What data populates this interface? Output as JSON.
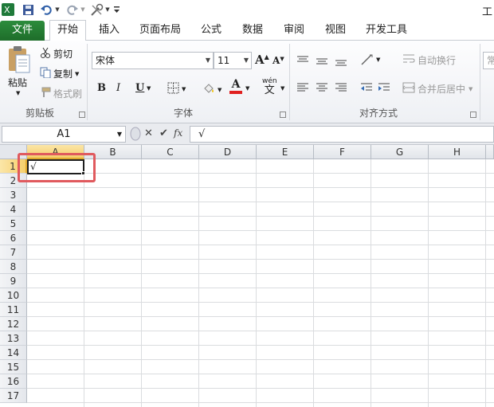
{
  "quick_access": {
    "excel_icon": "excel-app-icon",
    "save_icon": "save-icon",
    "undo_icon": "undo-icon",
    "redo_icon": "redo-icon",
    "tools_icon": "tools-icon",
    "customize_icon": "customize-qat-icon"
  },
  "window": {
    "title_fragment": "工"
  },
  "tabs": [
    {
      "label": "文件"
    },
    {
      "label": "开始"
    },
    {
      "label": "插入"
    },
    {
      "label": "页面布局"
    },
    {
      "label": "公式"
    },
    {
      "label": "数据"
    },
    {
      "label": "审阅"
    },
    {
      "label": "视图"
    },
    {
      "label": "开发工具"
    }
  ],
  "ribbon": {
    "clipboard": {
      "label": "剪贴板",
      "paste": "粘贴",
      "cut": "剪切",
      "copy": "复制",
      "format_painter": "格式刷"
    },
    "font": {
      "label": "字体",
      "font_name": "宋体",
      "font_size": "11",
      "bold": "B",
      "italic": "I",
      "underline": "U",
      "grow": "A",
      "shrink": "A",
      "font_color_letter": "A",
      "phonetic": "wén"
    },
    "alignment": {
      "label": "对齐方式",
      "wrap_text": "自动换行",
      "merge_center": "合并后居中"
    },
    "number": {
      "partial": "常"
    }
  },
  "formula_bar": {
    "name_box": "A1",
    "cancel_icon": "cancel-icon",
    "enter_icon": "enter-icon",
    "fx": "fx",
    "value": "√"
  },
  "sheet": {
    "columns": [
      "A",
      "B",
      "C",
      "D",
      "E",
      "F",
      "G",
      "H"
    ],
    "rows": [
      "1",
      "2",
      "3",
      "4",
      "5",
      "6",
      "7",
      "8",
      "9",
      "10",
      "11",
      "12",
      "13",
      "14",
      "15",
      "16",
      "17"
    ],
    "selected_column": "A",
    "selected_row": "1",
    "active_cell": "A1",
    "active_value": "√"
  },
  "colors": {
    "file_tab": "#217346",
    "selection_header": "#f6cf6b",
    "highlight_box": "#e05a5e",
    "font_color_bar": "#e02020"
  }
}
